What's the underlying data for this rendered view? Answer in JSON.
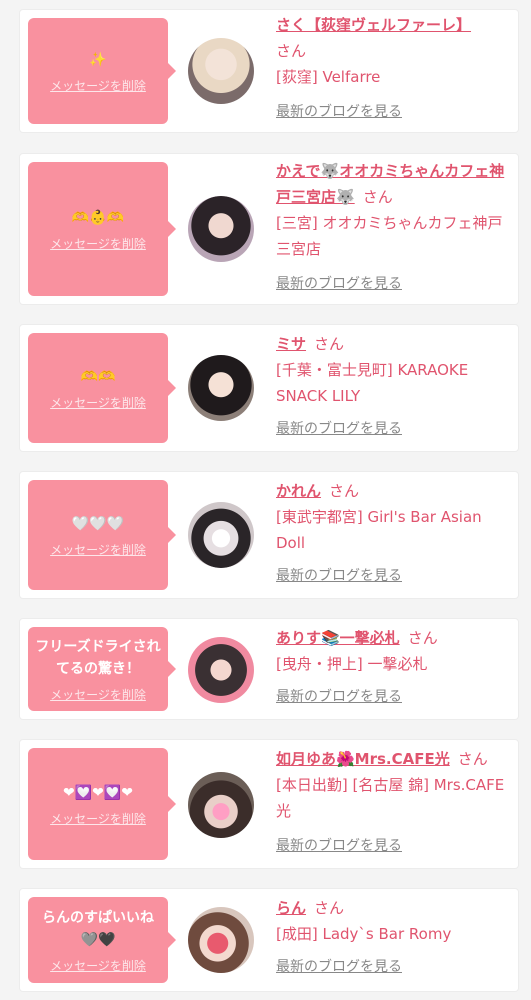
{
  "cards": [
    {
      "message": "✨",
      "delete": "メッセージを削除",
      "name": "さく【荻窪ヴェルファーレ】",
      "honorific": "さん",
      "shop": "[荻窪] Velfarre",
      "blog": "最新のブログを見る"
    },
    {
      "message": "🫶👶🫶",
      "delete": "メッセージを削除",
      "name": "かえで🐺オオカミちゃんカフェ神戸三宮店🐺",
      "honorific": "さん",
      "shop": "[三宮] オオカミちゃんカフェ神戸三宮店",
      "blog": "最新のブログを見る"
    },
    {
      "message": "🫶🫶",
      "delete": "メッセージを削除",
      "name": "ミサ",
      "honorific": "さん",
      "shop": "[千葉・富士見町] KARAOKE SNACK LILY",
      "blog": "最新のブログを見る"
    },
    {
      "message": "🤍🤍🤍",
      "delete": "メッセージを削除",
      "name": "かれん",
      "honorific": "さん",
      "shop": "[東武宇都宮] Girl's Bar Asian Doll",
      "blog": "最新のブログを見る"
    },
    {
      "message": "フリーズドライされてるの驚き！",
      "delete": "メッセージを削除",
      "name": "ありす📚一撃必札",
      "honorific": "さん",
      "shop": "[曳舟・押上] 一撃必札",
      "blog": "最新のブログを見る"
    },
    {
      "message": "❤💟❤💟❤",
      "delete": "メッセージを削除",
      "name": "如月ゆあ🌺Mrs.CAFE光",
      "honorific": "さん",
      "shop": "[本日出勤] [名古屋 錦] Mrs.CAFE 光",
      "blog": "最新のブログを見る"
    },
    {
      "message": "らんのすぱいいね🩶🖤",
      "delete": "メッセージを削除",
      "name": "らん",
      "honorific": "さん",
      "shop": "[成田] Lady`s Bar Romy",
      "blog": "最新のブログを見る"
    }
  ]
}
